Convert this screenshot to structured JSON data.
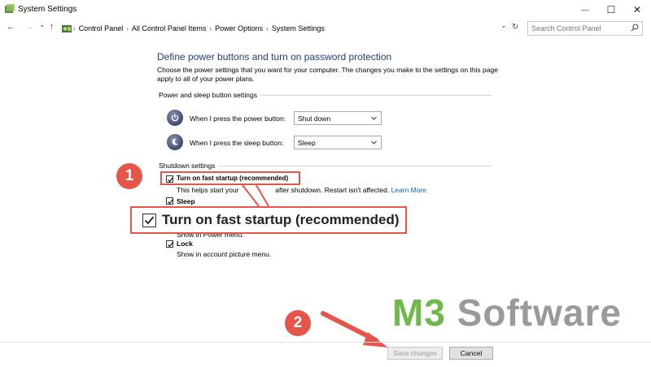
{
  "window": {
    "title": "System Settings",
    "minimize_glyph": "—",
    "maximize_glyph": "☐",
    "close_glyph": "✕"
  },
  "nav": {
    "back_glyph": "←",
    "forward_glyph": "→",
    "dropdown_glyph": "⌄",
    "up_glyph": "↑",
    "refresh_glyph": "↻",
    "history_dropdown_glyph": "⌄"
  },
  "breadcrumbs": [
    "Control Panel",
    "All Control Panel Items",
    "Power Options",
    "System Settings"
  ],
  "search": {
    "placeholder": "Search Control Panel",
    "icon": "search-icon"
  },
  "page": {
    "heading": "Define power buttons and turn on password protection",
    "description": "Choose the power settings that you want for your computer. The changes you make to the settings on this page apply to all of your power plans."
  },
  "power_sleep": {
    "title": "Power and sleep button settings",
    "power_label": "When I press the power button:",
    "power_value": "Shut down",
    "sleep_label": "When I press the sleep button:",
    "sleep_value": "Sleep"
  },
  "shutdown": {
    "title": "Shutdown settings",
    "fast_startup_label": "Turn on fast startup (recommended)",
    "fast_startup_desc": "This helps start your",
    "fast_startup_desc2": "after shutdown. Restart isn't affected.",
    "learn_more": "Learn More",
    "sleep_label": "Sleep",
    "sleep_desc": "Show in Power menu.",
    "lock_label": "Lock",
    "lock_desc": "Show in account picture menu."
  },
  "callout": {
    "zoom_label": "Turn on fast startup (recommended)",
    "badge1": "1",
    "badge2": "2",
    "accent": "#e5554a"
  },
  "watermark": {
    "part1": "M3",
    "part2": " Software"
  },
  "buttons": {
    "save": "Save changes",
    "cancel": "Cancel"
  }
}
